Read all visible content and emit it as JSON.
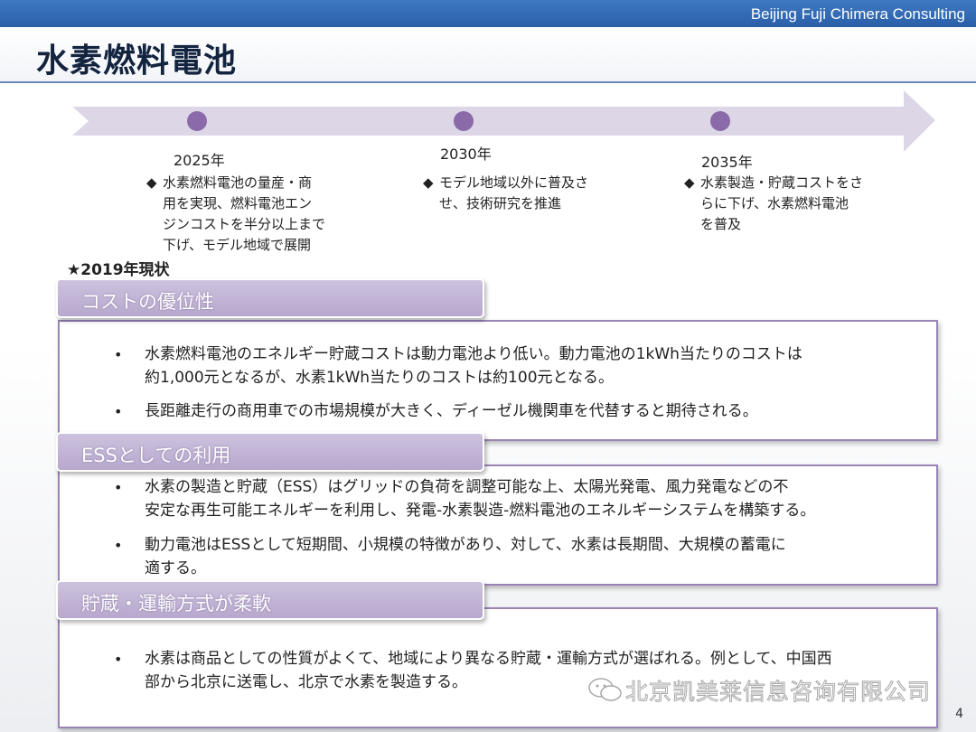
{
  "header": {
    "company": "Beijing Fuji Chimera Consulting",
    "title": "水素燃料電池"
  },
  "timeline": [
    {
      "year": "2025年",
      "text_lines": [
        "水素燃料電池の量産・商",
        "用を実現、燃料電池エン",
        "ジンコストを半分以上まで",
        "下げ、モデル地域で展開"
      ]
    },
    {
      "year": "2030年",
      "text_lines": [
        "モデル地域以外に普及さ",
        "せ、技術研究を推進"
      ]
    },
    {
      "year": "2035年",
      "text_lines": [
        "水素製造・貯蔵コストをさ",
        "らに下げ、水素燃料電池",
        "を普及"
      ]
    }
  ],
  "status_heading": "★2019年現状",
  "sections": [
    {
      "tab": "コストの優位性",
      "bullets": [
        [
          "水素燃料電池のエネルギー貯蔵コストは動力電池より低い。動力電池の1kWh当たりのコストは",
          "約1,000元となるが、水素1kWh当たりのコストは約100元となる。"
        ],
        [
          "長距離走行の商用車での市場規模が大きく、ディーゼル機関車を代替すると期待される。"
        ]
      ]
    },
    {
      "tab": "ESSとしての利用",
      "bullets": [
        [
          "水素の製造と貯蔵（ESS）はグリッドの負荷を調整可能な上、太陽光発電、風力発電などの不",
          "安定な再生可能エネルギーを利用し、発電-水素製造-燃料電池のエネルギーシステムを構築する。"
        ],
        [
          "動力電池はESSとして短期間、小規模の特徴があり、対して、水素は長期間、大規模の蓄電に",
          "適する。"
        ]
      ]
    },
    {
      "tab": "貯蔵・運輸方式が柔軟",
      "bullets": [
        [
          "水素は商品としての性質がよくて、地域により異なる貯蔵・運輸方式が選ばれる。例として、中国西",
          "部から北京に送電し、北京で水素を製造する。"
        ]
      ]
    }
  ],
  "bullet_symbol": "•",
  "milestone_symbol": "◆",
  "watermark": "北京凯美莱信息咨询有限公司",
  "page_number": "4",
  "colors": {
    "top_bar": "#2a5fa8",
    "accent_purple": "#8a6aa9",
    "tab_fill": "#b7a8cd",
    "arrow_fill": "#dcd6e6"
  }
}
